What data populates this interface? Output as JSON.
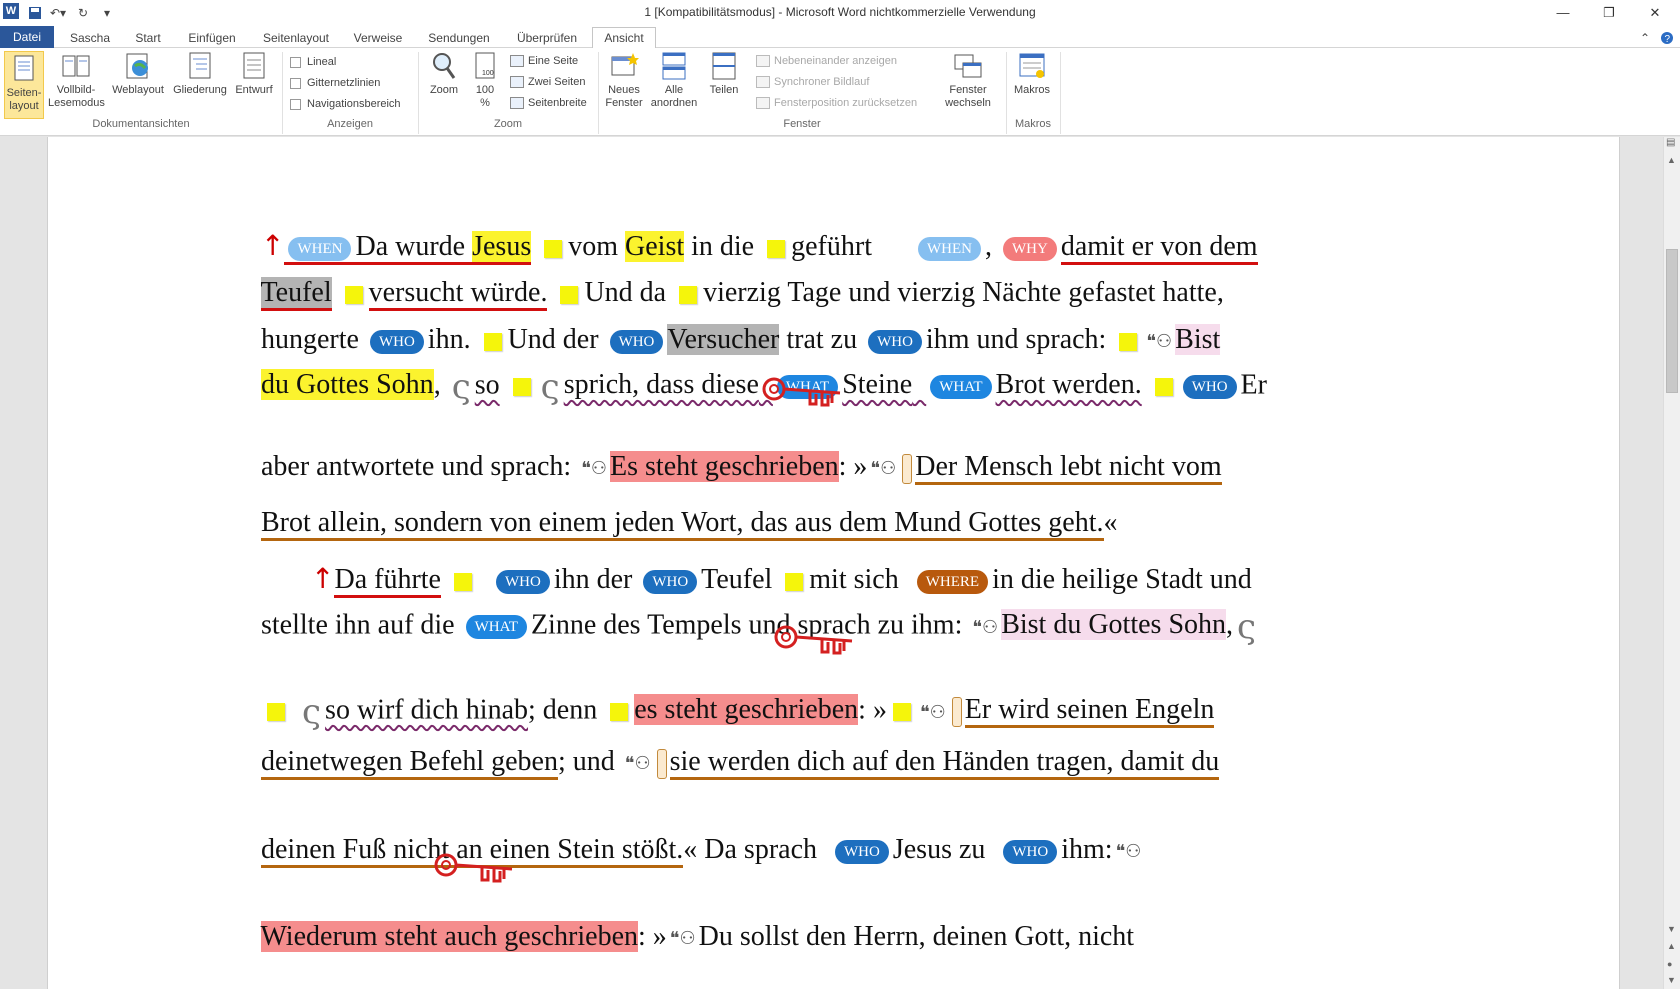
{
  "window": {
    "title": "1 [Kompatibilitätsmodus] - Microsoft Word nichtkommerzielle Verwendung",
    "app_icon": "word-icon",
    "controls": [
      "minimize-icon",
      "restore-icon",
      "close-icon"
    ]
  },
  "quick_access": {
    "app_letter": "W"
  },
  "tabs": [
    "Datei",
    "Sascha",
    "Start",
    "Einfügen",
    "Seitenlayout",
    "Verweise",
    "Sendungen",
    "Überprüfen",
    "Ansicht"
  ],
  "ribbon": {
    "dokumentansichten": {
      "label": "Dokumentansichten",
      "buttons": [
        "Seiten-\nlayout",
        "Vollbild-\nLesemodus",
        "Weblayout",
        "Gliederung",
        "Entwurf"
      ]
    },
    "anzeigen": {
      "label": "Anzeigen",
      "options": [
        "Lineal",
        "Gitternetzlinien",
        "Navigationsbereich"
      ]
    },
    "zoom": {
      "label": "Zoom",
      "zoom_btn": "Zoom",
      "percent_btn": "100\n%",
      "options": [
        "Eine Seite",
        "Zwei Seiten",
        "Seitenbreite"
      ]
    },
    "fenster": {
      "label": "Fenster",
      "neues": "Neues\nFenster",
      "alle": "Alle\nanordnen",
      "teilen": "Teilen",
      "disabled_options": [
        "Nebeneinander anzeigen",
        "Synchroner Bildlauf",
        "Fensterposition zurücksetzen"
      ],
      "wechseln": "Fenster\nwechseln"
    },
    "makros": {
      "label": "Makros",
      "btn": "Makros"
    }
  },
  "document": {
    "l1": {
      "t1": "Da",
      "t2": "wurde",
      "t3": "Jesus",
      "t4": "vom",
      "t5": "Geist",
      "t6": "in",
      "t7": "die",
      "t8": "geführt",
      "t9": ",",
      "t10": "damit er von dem"
    },
    "l2": {
      "t1": "Teufel",
      "t2": "versucht würde.",
      "t3": "Und da",
      "t4": "vierzig Tage und vierzig Nächte gefastet hatte,"
    },
    "l3": {
      "t1": "hungerte",
      "t2": "ihn.",
      "t3": "Und der",
      "t4": "Versucher",
      "t5": "trat zu",
      "t6": "ihm und sprach:",
      "t7": "Bist"
    },
    "l4": {
      "t1": "du Gottes Sohn",
      "t2": ",",
      "t3": "so",
      "t4": "sprich, dass diese",
      "t5": "Steine",
      "t6": "Brot werden.",
      "t7": "Er"
    },
    "l5": {
      "t1": "aber antwortete und sprach:",
      "t2": "Es steht geschrieben",
      "t3": ":",
      "t4": "»",
      "t5": "Der Mensch lebt nicht vom"
    },
    "l6": {
      "t1": "Brot allein, sondern von einem jeden Wort, das aus dem Mund Gottes geht.",
      "t2": "«"
    },
    "l7": {
      "t1": "Da führte",
      "t2": "ihn der",
      "t3": "Teufel",
      "t4": "mit sich",
      "t5": "in die heilige Stadt und"
    },
    "l8": {
      "t1": "stellte ihn auf die",
      "t2": "Zinne des Tempels und sprach zu ihm:",
      "t3": "Bist du Gottes Sohn",
      "t4": ","
    },
    "l9": {
      "t1": "so wirf dich hinab",
      "t2": "; denn",
      "t3": "es steht geschrieben",
      "t4": ":",
      "t5": "»",
      "t6": "Er wird seinen Engeln"
    },
    "l10": {
      "t1": "deinetwegen Befehl geben",
      "t2": "; und",
      "t3": "sie werden dich auf den Händen tragen, damit du"
    },
    "l11": {
      "t1": "deinen Fuß nicht an einen Stein stößt.",
      "t2": "« Da sprach",
      "t3": "Jesus zu",
      "t4": "ihm:"
    },
    "l12": {
      "t1": "Wiederum steht auch geschrieben",
      "t2": ":",
      "t3": "»",
      "t4": "Du sollst den Herrn, deinen Gott, nicht"
    }
  },
  "tags": {
    "when": "WHEN",
    "why": "WHY",
    "who": "WHO",
    "what": "WHAT",
    "where": "WHERE"
  },
  "colors": {
    "accent": "#2b579a",
    "when": "#86bff0",
    "why": "#f37b7b",
    "who": "#1d6fbf",
    "what": "#1e86e0",
    "where": "#b8590d",
    "highlight_yellow": "#fbf32e",
    "highlight_red": "#f58d8d",
    "highlight_pink": "#f6dcec",
    "highlight_gray": "#b4b4b4",
    "underline_red": "#d20f0f",
    "underline_brown": "#b4660f"
  },
  "icons": [
    "sticky-note-icon",
    "speaker-icon",
    "key-icon",
    "scroll-icon",
    "serpent-icon",
    "up-arrow-icon"
  ]
}
